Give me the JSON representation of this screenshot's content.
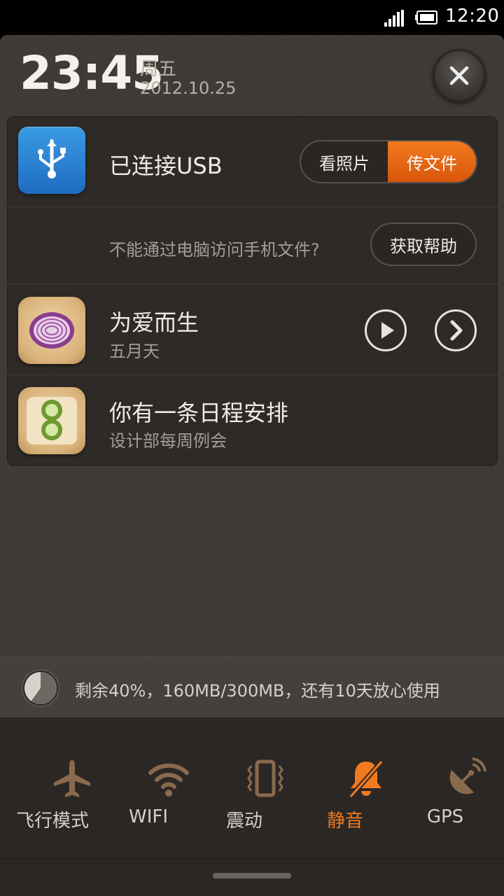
{
  "status_bar": {
    "time": "12:20"
  },
  "header": {
    "clock": "23:45",
    "weekday": "周五",
    "date": "2012.10.25"
  },
  "usb": {
    "title": "已连接USB",
    "option_photos": "看照片",
    "option_files": "传文件",
    "hint": "不能通过电脑访问手机文件?",
    "help_label": "获取帮助"
  },
  "music": {
    "title": "为爱而生",
    "artist": "五月天"
  },
  "calendar": {
    "title": "你有一条日程安排",
    "subtitle": "设计部每周例会"
  },
  "data_usage": {
    "text": "剩余40%，160MB/300MB，还有10天放心使用",
    "remaining_fraction": 0.4
  },
  "toggles": [
    {
      "label": "飞行模式",
      "icon": "airplane-icon",
      "active": false
    },
    {
      "label": "WIFI",
      "icon": "wifi-icon",
      "active": false
    },
    {
      "label": "震动",
      "icon": "vibrate-icon",
      "active": false
    },
    {
      "label": "静音",
      "icon": "mute-bell-icon",
      "active": true
    },
    {
      "label": "GPS",
      "icon": "gps-icon",
      "active": false
    }
  ],
  "colors": {
    "accent": "#f27a1e",
    "usb_blue": "#2a85d6",
    "panel": "#3f3a36"
  }
}
